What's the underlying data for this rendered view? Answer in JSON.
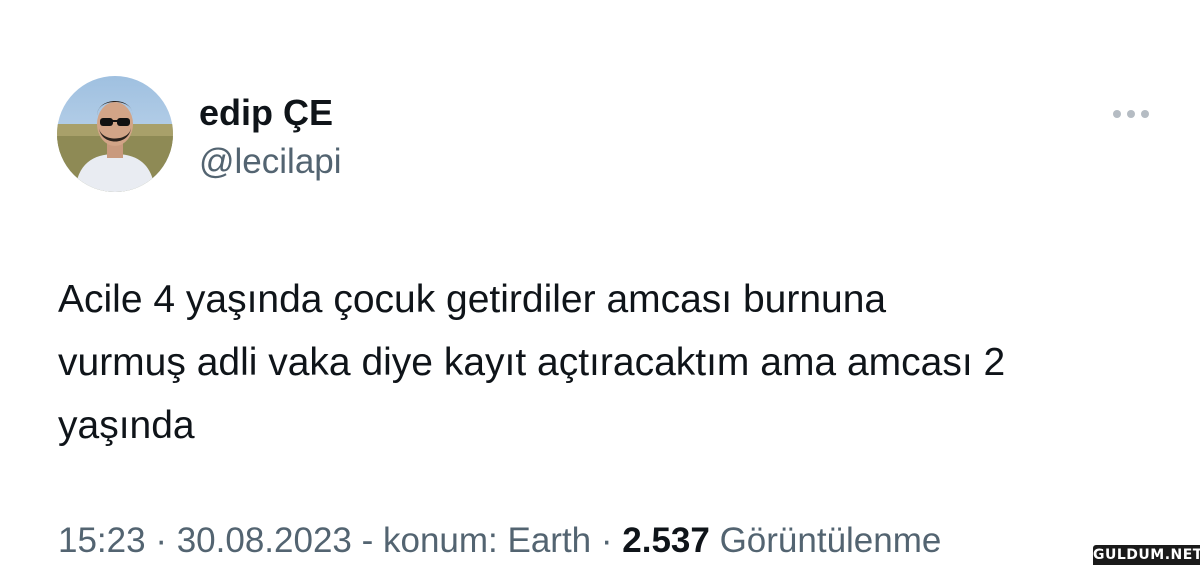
{
  "tweet": {
    "author": {
      "display_name": "edip ÇE",
      "handle": "@lecilapi",
      "avatar_icon": "profile-photo"
    },
    "more_icon": "ellipsis-icon",
    "text": "Acile 4 yaşında çocuk getirdiler amcası burnuna\nvurmuş adli vaka diye kayıt açtıracaktım ama amcası 2\nyaşında",
    "meta": {
      "time": "15:23",
      "separator1": " · ",
      "date": "30.08.2023",
      "location": " - konum: Earth",
      "separator2": " · ",
      "views_count": "2.537",
      "views_label": " Görüntülenme"
    }
  },
  "watermark": {
    "text": "GULDUM.NET"
  },
  "colors": {
    "text_primary": "#0f1419",
    "text_secondary": "#536471",
    "background": "#ffffff"
  }
}
